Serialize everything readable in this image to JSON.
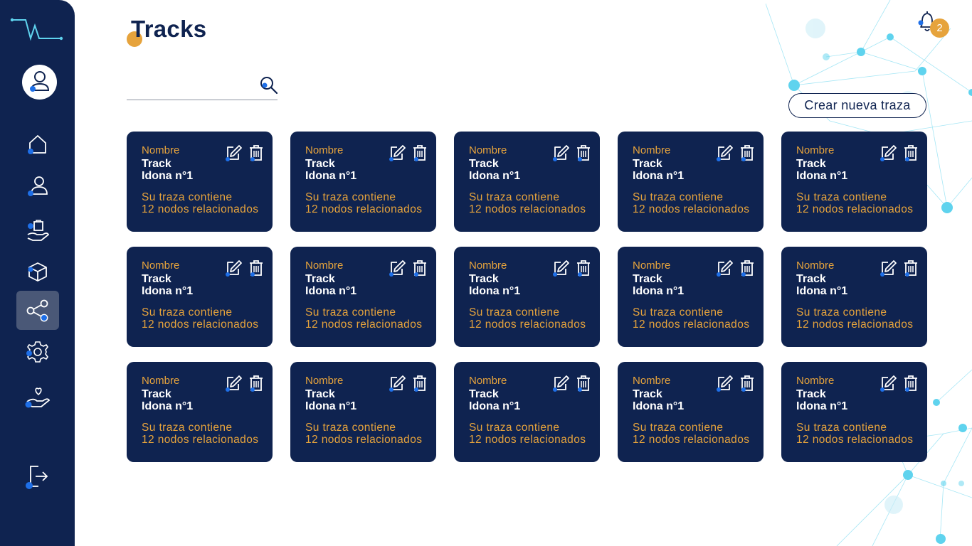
{
  "header": {
    "title": "Tracks",
    "notifications_count": "2"
  },
  "search": {
    "value": "",
    "placeholder": ""
  },
  "toolbar": {
    "create_label": "Crear nueva traza"
  },
  "sidebar": {
    "items": [
      {
        "icon": "home-icon",
        "active": false
      },
      {
        "icon": "user-icon",
        "active": false
      },
      {
        "icon": "hand-bag-icon",
        "active": false
      },
      {
        "icon": "box-icon",
        "active": false
      },
      {
        "icon": "share-nodes-icon",
        "active": true
      },
      {
        "icon": "gear-icon",
        "active": false
      },
      {
        "icon": "hand-heart-icon",
        "active": false
      }
    ],
    "logout_icon": "logout-icon"
  },
  "cards": [
    {
      "label": "Nombre",
      "name": "Track\nIdona n°1",
      "description": "Su traza contiene\n12 nodos relacionados"
    },
    {
      "label": "Nombre",
      "name": "Track\nIdona n°1",
      "description": "Su traza contiene\n12 nodos relacionados"
    },
    {
      "label": "Nombre",
      "name": "Track\nIdona n°1",
      "description": "Su traza contiene\n12 nodos relacionados"
    },
    {
      "label": "Nombre",
      "name": "Track\nIdona n°1",
      "description": "Su traza contiene\n12 nodos relacionados"
    },
    {
      "label": "Nombre",
      "name": "Track\nIdona n°1",
      "description": "Su traza contiene\n12 nodos relacionados"
    },
    {
      "label": "Nombre",
      "name": "Track\nIdona n°1",
      "description": "Su traza contiene\n12 nodos relacionados"
    },
    {
      "label": "Nombre",
      "name": "Track\nIdona n°1",
      "description": "Su traza contiene\n12 nodos relacionados"
    },
    {
      "label": "Nombre",
      "name": "Track\nIdona n°1",
      "description": "Su traza contiene\n12 nodos relacionados"
    },
    {
      "label": "Nombre",
      "name": "Track\nIdona n°1",
      "description": "Su traza contiene\n12 nodos relacionados"
    },
    {
      "label": "Nombre",
      "name": "Track\nIdona n°1",
      "description": "Su traza contiene\n12 nodos relacionados"
    },
    {
      "label": "Nombre",
      "name": "Track\nIdona n°1",
      "description": "Su traza contiene\n12 nodos relacionados"
    },
    {
      "label": "Nombre",
      "name": "Track\nIdona n°1",
      "description": "Su traza contiene\n12 nodos relacionados"
    },
    {
      "label": "Nombre",
      "name": "Track\nIdona n°1",
      "description": "Su traza contiene\n12 nodos relacionados"
    },
    {
      "label": "Nombre",
      "name": "Track\nIdona n°1",
      "description": "Su traza contiene\n12 nodos relacionados"
    },
    {
      "label": "Nombre",
      "name": "Track\nIdona n°1",
      "description": "Su traza contiene\n12 nodos relacionados"
    }
  ],
  "colors": {
    "navy": "#0f2350",
    "accent": "#e6a33c",
    "dot_blue": "#1e6fe8",
    "network": "#5fd3ee"
  }
}
